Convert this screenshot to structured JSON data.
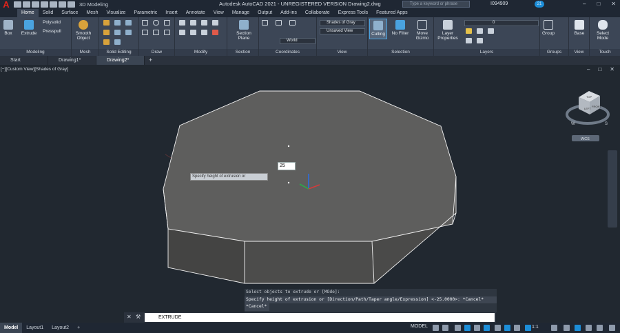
{
  "app": {
    "logo": "A",
    "title": "Autodesk AutoCAD 2021 - UNREGISTERED VERSION   Drawing2.dwg",
    "workspace": "3D Modeling",
    "search_placeholder": "Type a keyword or phrase",
    "user": "I094909",
    "notifications": "21"
  },
  "ribbon_tabs": [
    "Home",
    "Solid",
    "Surface",
    "Mesh",
    "Visualize",
    "Parametric",
    "Insert",
    "Annotate",
    "View",
    "Manage",
    "Output",
    "Add-ins",
    "Collaborate",
    "Express Tools",
    "Featured Apps"
  ],
  "panels": {
    "modeling": "Modeling",
    "mesh": "Mesh",
    "solid_editing": "Solid Editing",
    "draw": "Draw",
    "modify": "Modify",
    "section": "Section",
    "coordinates": "Coordinates",
    "view": "View",
    "selection": "Selection",
    "layers": "Layers",
    "groups": "Groups",
    "view2": "View",
    "touch": "Touch"
  },
  "buttons": {
    "box": "Box",
    "extrude": "Extrude",
    "polysolid": "Polysolid",
    "presspull": "Presspull",
    "smooth": "Smooth",
    "object": "Object",
    "section": "Section",
    "plane": "Plane",
    "culling": "Culling",
    "no_filter": "No Filter",
    "move": "Move",
    "gizmo": "Gizmo",
    "layer": "Layer",
    "properties": "Properties",
    "group": "Group",
    "base": "Base",
    "select": "Select",
    "mode": "Mode"
  },
  "combos": {
    "world": "World",
    "visual_style": "Shades of Gray",
    "view": "Unsaved View",
    "layer": "0"
  },
  "doc_tabs": [
    "Start",
    "Drawing1*",
    "Drawing2*"
  ],
  "viewport": {
    "label": "[−][Custom View][Shades of Gray]",
    "height_input": "25",
    "tooltip": "Specify height of extrusion or",
    "wcs": "WCS",
    "cube_top": "TOP",
    "cube_left": "LEFT",
    "cube_front": "FRONT",
    "compass_w": "W",
    "compass_s": "S"
  },
  "command_history": [
    "Select objects to extrude or [MOde]:",
    "Specify height of extrusion or [Direction/Path/Taper angle/Expression] <-25.0000>: *Cancel*",
    "*Cancel*"
  ],
  "command_input": "EXTRUDE",
  "status": {
    "layouts": [
      "Model",
      "Layout1",
      "Layout2"
    ],
    "model_badge": "MODEL",
    "scale": "1:1"
  },
  "colors": {
    "accent": "#1c8ed9",
    "face_top": "#5e5e5d",
    "face_side": "#4c4c4b",
    "edge": "#f2f2f2"
  }
}
